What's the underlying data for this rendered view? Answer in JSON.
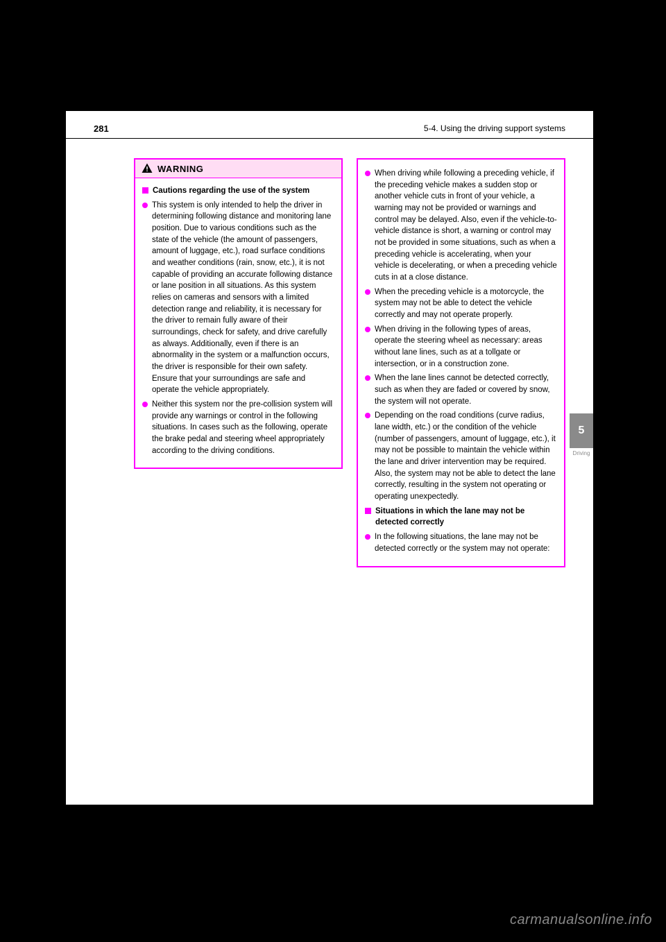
{
  "header": {
    "page_number": "281",
    "section": "5-4. Using the driving support systems"
  },
  "side_tab": {
    "number": "5",
    "caption": "Driving"
  },
  "watermark": "carmanualsonline.info",
  "left_box": {
    "warning_label": "WARNING",
    "heading": "Cautions regarding the use of the system",
    "items": [
      "This system is only intended to help the driver in determining following distance and monitoring lane position. Due to various conditions such as the state of the vehicle (the amount of passengers, amount of luggage, etc.), road surface conditions and weather conditions (rain, snow, etc.), it is not capable of providing an accurate following distance or lane position in all situations. As this system relies on cameras and sensors with a limited detection range and reliability, it is necessary for the driver to remain fully aware of their surroundings, check for safety, and drive carefully as always. Additionally, even if there is an abnormality in the system or a malfunction occurs, the driver is responsible for their own safety. Ensure that your surroundings are safe and operate the vehicle appropriately.",
      "Neither this system nor the pre-collision system will provide any warnings or control in the following situations. In cases such as the following, operate the brake pedal and steering wheel appropriately according to the driving conditions."
    ]
  },
  "right_box": {
    "items": [
      "When driving while following a preceding vehicle, if the preceding vehicle makes a sudden stop or another vehicle cuts in front of your vehicle, a warning may not be provided or warnings and control may be delayed. Also, even if the vehicle-to-vehicle distance is short, a warning or control may not be provided in some situations, such as when a preceding vehicle is accelerating, when your vehicle is decelerating, or when a preceding vehicle cuts in at a close distance.",
      "When the preceding vehicle is a motorcycle, the system may not be able to detect the vehicle correctly and may not operate properly.",
      "When driving in the following types of areas, operate the steering wheel as necessary: areas without lane lines, such as at a tollgate or intersection, or in a construction zone.",
      "When the lane lines cannot be detected correctly, such as when they are faded or covered by snow, the system will not operate.",
      "Depending on the road conditions (curve radius, lane width, etc.) or the condition of the vehicle (number of passengers, amount of luggage, etc.), it may not be possible to maintain the vehicle within the lane and driver intervention may be required. Also, the system may not be able to detect the lane correctly, resulting in the system not operating or operating unexpectedly."
    ],
    "heading2": "Situations in which the lane may not be detected correctly",
    "items2": [
      "In the following situations, the lane may not be detected correctly or the system may not operate:"
    ]
  }
}
